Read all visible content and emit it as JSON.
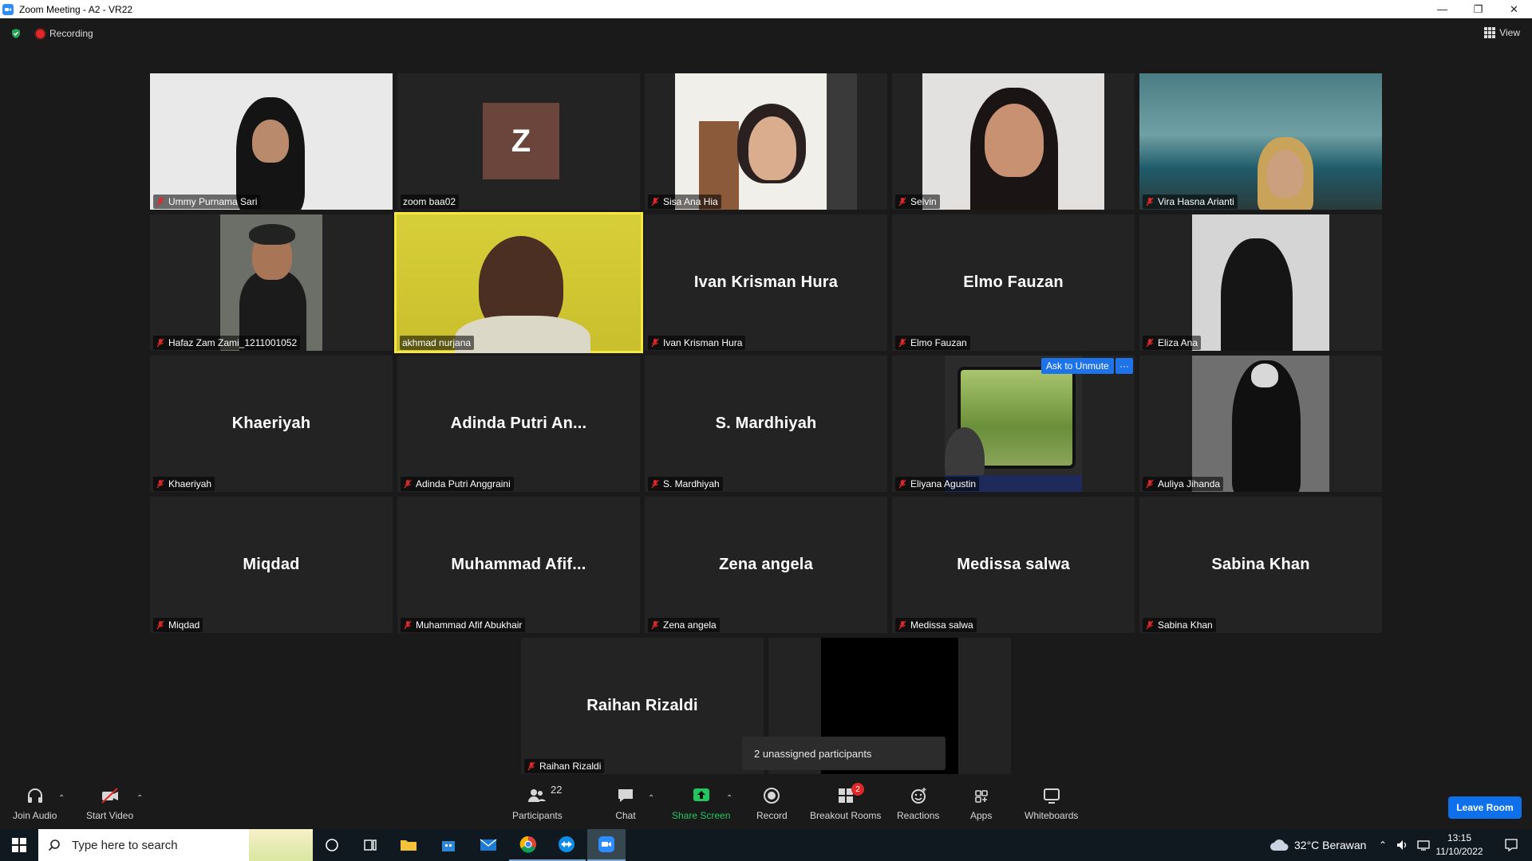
{
  "window": {
    "title": "Zoom Meeting - A2 - VR22",
    "min": "—",
    "restore": "❐",
    "close": "✕"
  },
  "status": {
    "recording": "Recording",
    "view": "View"
  },
  "tiles": [
    {
      "label": "Ummy Purnama Sari",
      "center": ""
    },
    {
      "label": "zoom baa02",
      "center": ""
    },
    {
      "label": "Sisa Ana Hia",
      "center": ""
    },
    {
      "label": "Selvin",
      "center": ""
    },
    {
      "label": "Vira Hasna Arianti",
      "center": ""
    },
    {
      "label": "Hafaz Zam Zami_1211001052",
      "center": ""
    },
    {
      "label": "akhmad nurjana",
      "center": ""
    },
    {
      "label": "Ivan Krisman Hura",
      "center": "Ivan Krisman Hura"
    },
    {
      "label": "Elmo Fauzan",
      "center": "Elmo Fauzan"
    },
    {
      "label": "Eliza Ana",
      "center": ""
    },
    {
      "label": "Khaeriyah",
      "center": "Khaeriyah"
    },
    {
      "label": "Adinda Putri Anggraini",
      "center": "Adinda  Putri  An..."
    },
    {
      "label": "S. Mardhiyah",
      "center": "S. Mardhiyah"
    },
    {
      "label": "Eliyana Agustin",
      "center": ""
    },
    {
      "label": "Auliya Jihanda",
      "center": ""
    },
    {
      "label": "Miqdad",
      "center": "Miqdad"
    },
    {
      "label": "Muhammad Afif Abukhair",
      "center": "Muhammad  Afif..."
    },
    {
      "label": "Zena angela",
      "center": "Zena angela"
    },
    {
      "label": "Medissa salwa",
      "center": "Medissa salwa"
    },
    {
      "label": "Sabina Khan",
      "center": "Sabina Khan"
    },
    {
      "label": "Raihan Rizaldi",
      "center": "Raihan Rizaldi"
    }
  ],
  "avatar_letter": "Z",
  "ask_to_unmute": "Ask to Unmute",
  "more": "···",
  "unassigned": "2 unassigned participants",
  "toolbar": {
    "join_audio": "Join Audio",
    "start_video": "Start Video",
    "participants": "Participants",
    "participants_count": "22",
    "chat": "Chat",
    "share_screen": "Share Screen",
    "record": "Record",
    "breakout_rooms": "Breakout Rooms",
    "breakout_badge": "2",
    "reactions": "Reactions",
    "apps": "Apps",
    "whiteboards": "Whiteboards",
    "leave_room": "Leave Room"
  },
  "taskbar": {
    "search_placeholder": "Type here to search",
    "weather": "32°C  Berawan",
    "time": "13:15",
    "date": "11/10/2022"
  },
  "colors": {
    "accent": "#0e71eb",
    "active_speaker": "#f5e642",
    "share_green": "#22c55e",
    "recording": "#e02828"
  }
}
